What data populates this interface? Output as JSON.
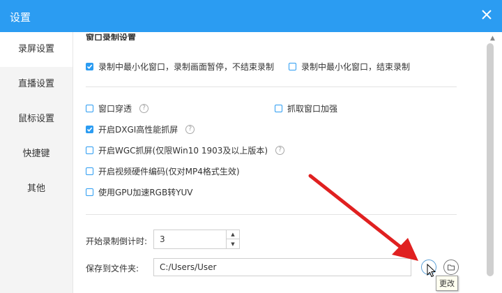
{
  "window": {
    "title": "设置"
  },
  "sidebar": {
    "items": [
      {
        "label": "录屏设置",
        "active": true
      },
      {
        "label": "直播设置",
        "active": false
      },
      {
        "label": "鼠标设置",
        "active": false
      },
      {
        "label": "快捷键",
        "active": false
      },
      {
        "label": "其他",
        "active": false
      }
    ]
  },
  "section": {
    "title": "窗口录制设置"
  },
  "options": {
    "minimize_pause": {
      "label": "录制中最小化窗口，录制画面暂停，不结束录制",
      "checked": true
    },
    "minimize_stop": {
      "label": "录制中最小化窗口，结束录制",
      "checked": false
    },
    "window_through": {
      "label": "窗口穿透",
      "checked": false
    },
    "capture_enhance": {
      "label": "抓取窗口加强",
      "checked": false
    },
    "dxgi": {
      "label": "开启DXGI高性能抓屏",
      "checked": true
    },
    "wgc": {
      "label": "开启WGC抓屏(仅限Win10 1903及以上版本)",
      "checked": false
    },
    "hw_encode": {
      "label": "开启视频硬件编码(仅对MP4格式生效)",
      "checked": false
    },
    "gpu_rgb": {
      "label": "使用GPU加速RGB转YUV",
      "checked": false
    },
    "help_glyph": "?"
  },
  "countdown": {
    "label": "开始录制倒计时:",
    "value": "3",
    "up_glyph": "▲",
    "down_glyph": "▼"
  },
  "save": {
    "label": "保存到文件夹:",
    "path": "C:/Users/User",
    "tooltip": "更改"
  },
  "colors": {
    "accent": "#2b9cf2",
    "arrow": "#e02020"
  }
}
